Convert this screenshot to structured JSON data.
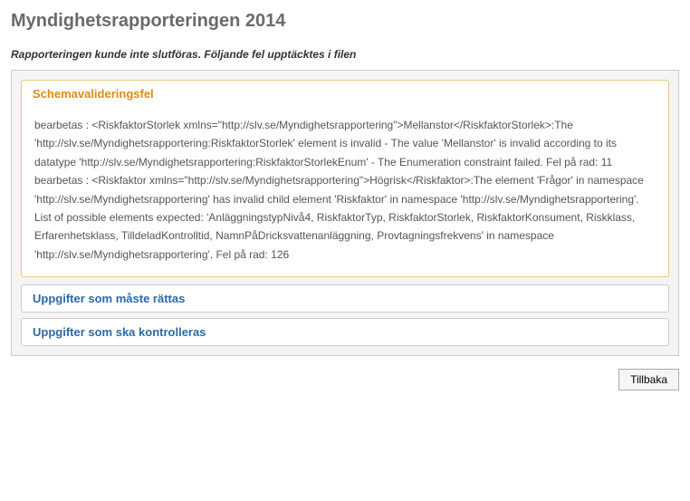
{
  "page": {
    "title": "Myndighetsrapporteringen 2014",
    "error_intro": "Rapporteringen kunde inte slutföras. Följande fel upptäcktes i filen"
  },
  "schema_section": {
    "header": "Schemavalideringsfel",
    "body": "bearbetas : <RiskfaktorStorlek xmlns=\"http://slv.se/Myndighetsrapportering\">Mellanstor</RiskfaktorStorlek>:The 'http://slv.se/Myndighetsrapportering:RiskfaktorStorlek' element is invalid - The value 'Mellanstor' is invalid according to its datatype 'http://slv.se/Myndighetsrapportering:RiskfaktorStorlekEnum' - The Enumeration constraint failed. Fel på rad: 11\nbearbetas : <Riskfaktor xmlns=\"http://slv.se/Myndighetsrapportering\">Högrisk</Riskfaktor>:The element 'Frågor' in namespace 'http://slv.se/Myndighetsrapportering' has invalid child element 'Riskfaktor' in namespace 'http://slv.se/Myndighetsrapportering'. List of possible elements expected: 'AnläggningstypNivå4, RiskfaktorTyp, RiskfaktorStorlek, RiskfaktorKonsument, Riskklass, Erfarenhetsklass, TilldeladKontrolltid, NamnPåDricksvattenanläggning, Provtagningsfrekvens' in namespace 'http://slv.se/Myndighetsrapportering'. Fel på rad: 126"
  },
  "sub_panels": {
    "must_fix": "Uppgifter som måste rättas",
    "should_check": "Uppgifter som ska kontrolleras"
  },
  "buttons": {
    "back": "Tillbaka"
  }
}
